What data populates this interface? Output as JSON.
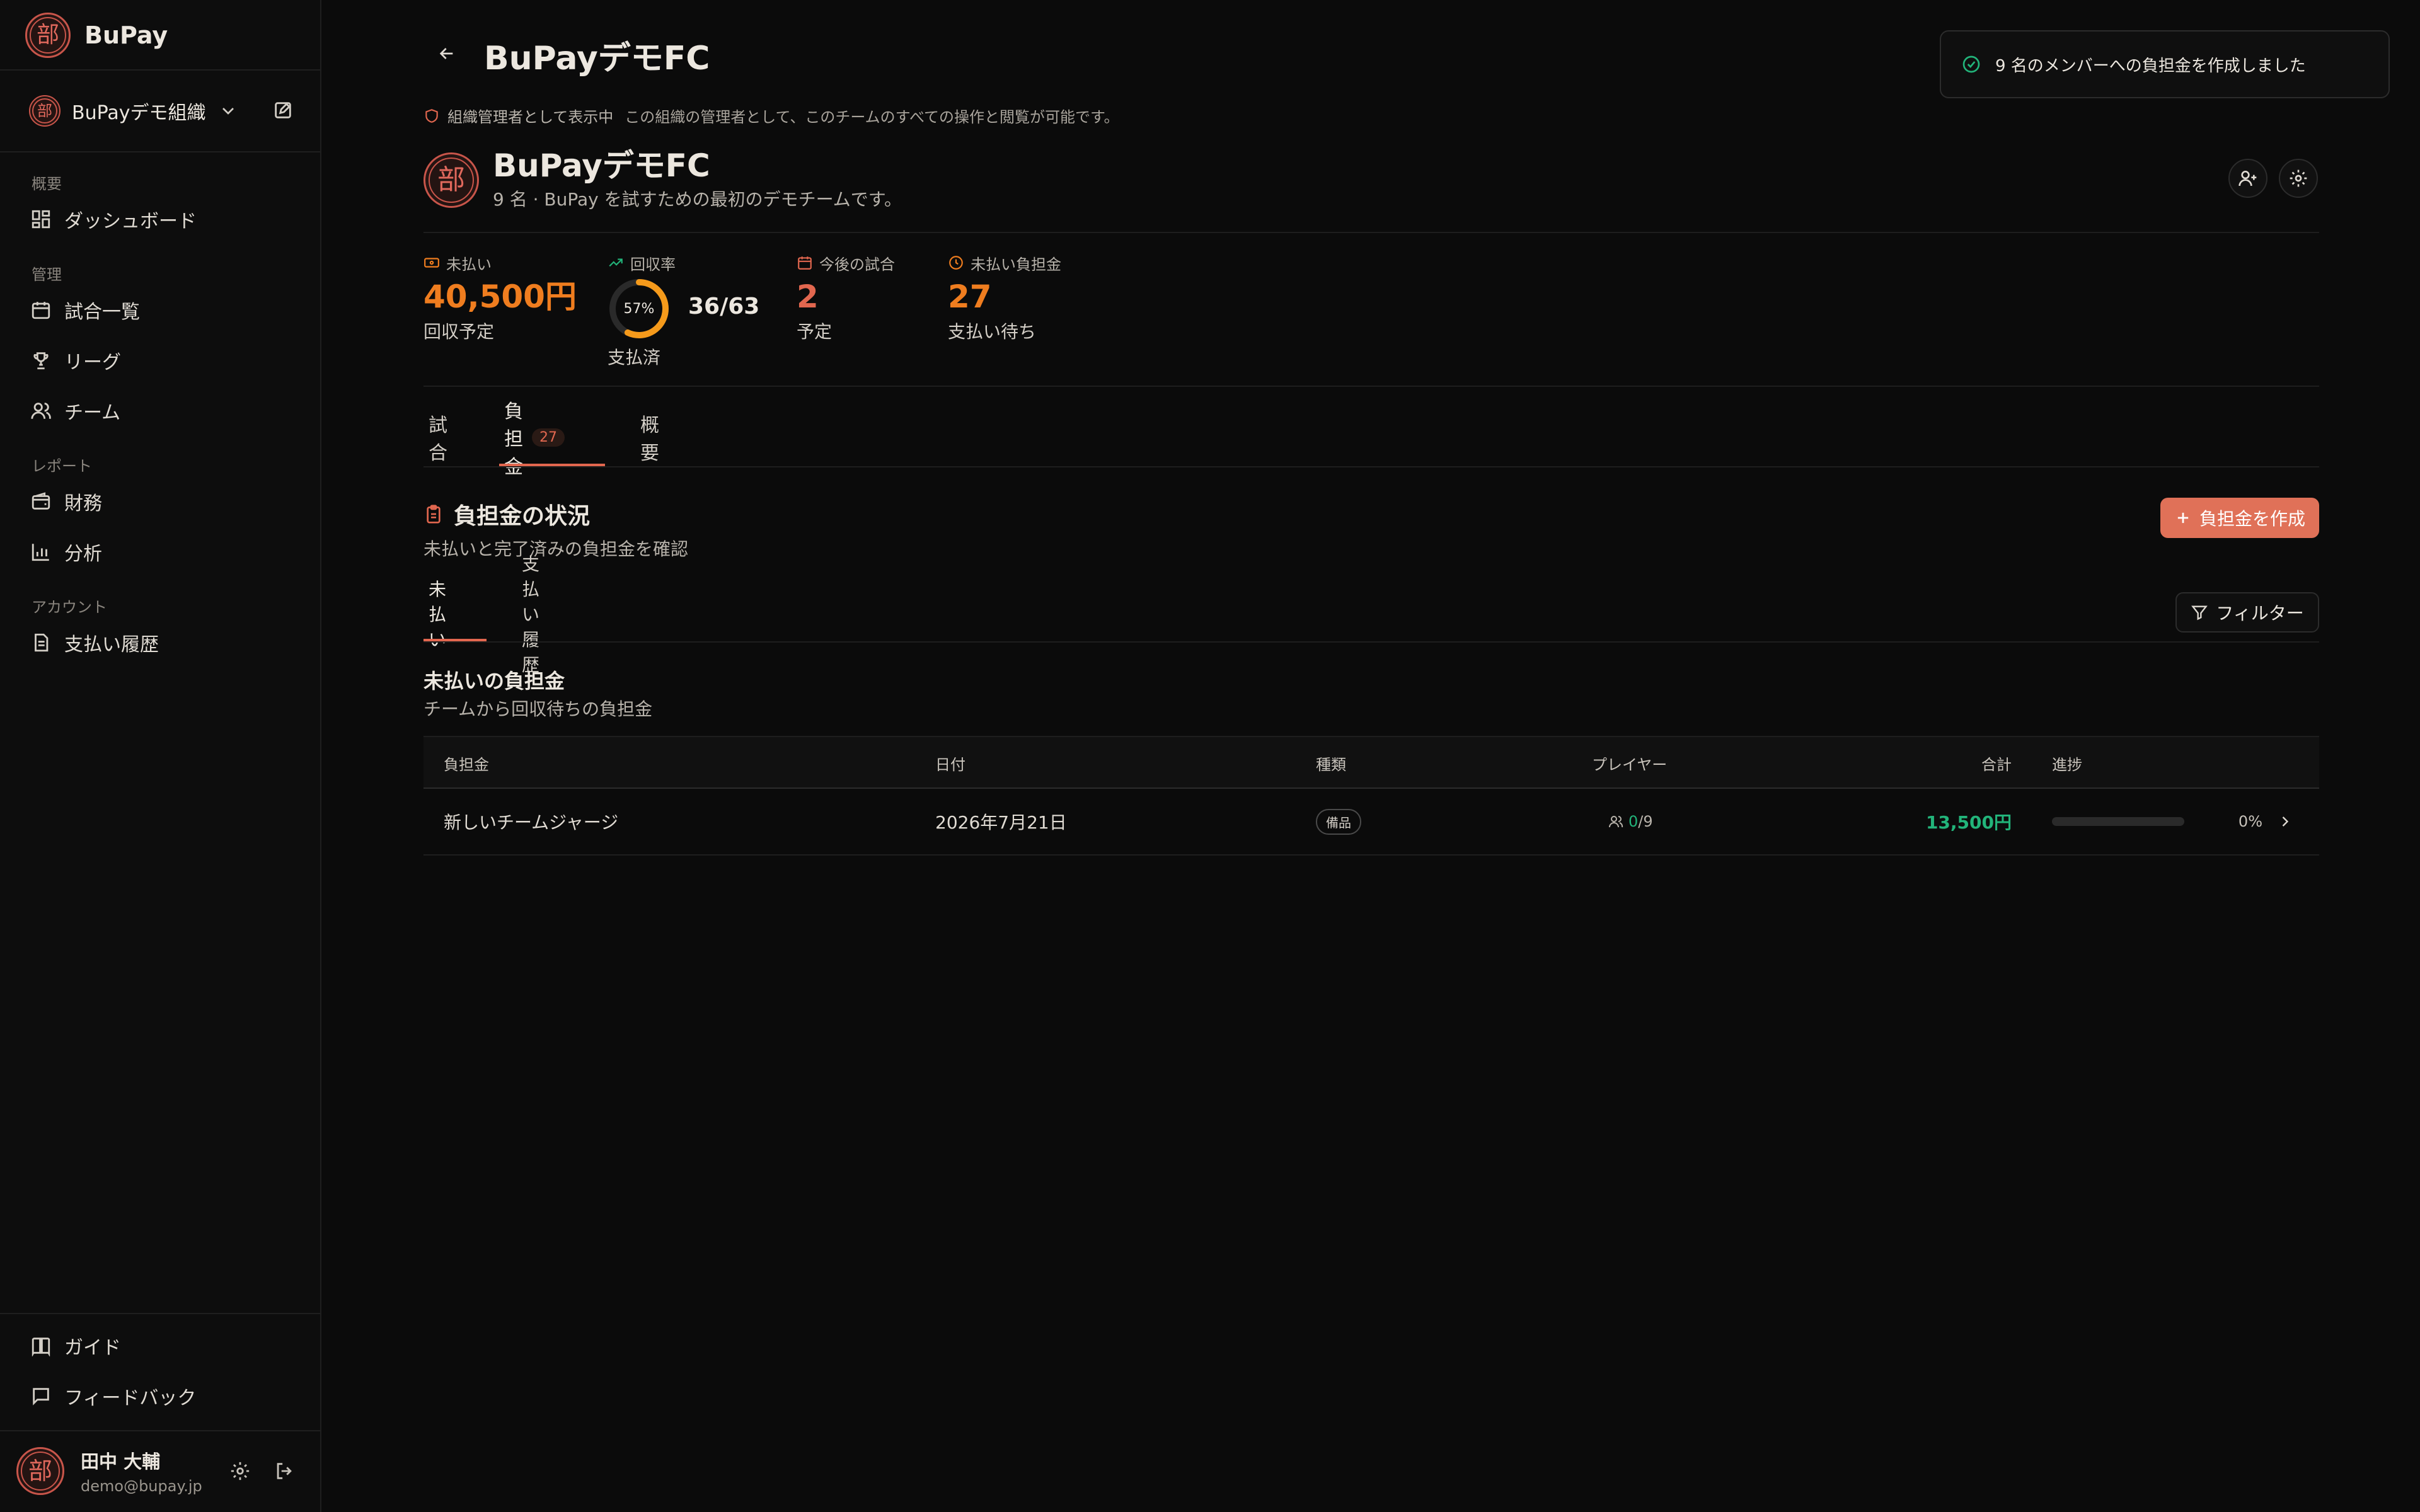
{
  "app": {
    "name": "BuPay",
    "seal_char": "部"
  },
  "org": {
    "name": "BuPayデモ組織"
  },
  "nav": {
    "sections": [
      {
        "label": "概要",
        "items": [
          {
            "label": "ダッシュボード",
            "icon": "grid-icon"
          }
        ]
      },
      {
        "label": "管理",
        "items": [
          {
            "label": "試合一覧",
            "icon": "calendar-icon"
          },
          {
            "label": "リーグ",
            "icon": "trophy-icon"
          },
          {
            "label": "チーム",
            "icon": "users-icon"
          }
        ]
      },
      {
        "label": "レポート",
        "items": [
          {
            "label": "財務",
            "icon": "wallet-icon"
          },
          {
            "label": "分析",
            "icon": "bar-chart-icon"
          }
        ]
      },
      {
        "label": "アカウント",
        "items": [
          {
            "label": "支払い履歴",
            "icon": "file-icon"
          }
        ]
      }
    ],
    "footer": [
      {
        "label": "ガイド",
        "icon": "book-icon"
      },
      {
        "label": "フィードバック",
        "icon": "message-icon"
      }
    ]
  },
  "user": {
    "name": "田中 大輔",
    "email": "demo@bupay.jp"
  },
  "page": {
    "title": "BuPayデモFC",
    "admin_notice": {
      "strong": "組織管理者として表示中",
      "desc": "この組織の管理者として、このチームのすべての操作と閲覧が可能です。"
    }
  },
  "team": {
    "name": "BuPayデモFC",
    "subtitle": "9 名 · BuPay を試すための最初のデモチームです。"
  },
  "stats": {
    "unpaid": {
      "label": "未払い",
      "value": "40,500円",
      "sub": "回収予定"
    },
    "collection": {
      "label": "回収率",
      "percent": 57,
      "percent_text": "57%",
      "count": "36/63",
      "sub": "支払済"
    },
    "upcoming": {
      "label": "今後の試合",
      "value": "2",
      "sub": "予定"
    },
    "pending": {
      "label": "未払い負担金",
      "value": "27",
      "sub": "支払い待ち"
    }
  },
  "tabs": [
    {
      "label": "試合"
    },
    {
      "label": "負担金",
      "badge": "27"
    },
    {
      "label": "概要"
    }
  ],
  "section": {
    "title": "負担金の状況",
    "desc": "未払いと完了済みの負担金を確認",
    "create_label": "負担金を作成"
  },
  "subtabs": [
    {
      "label": "未払い"
    },
    {
      "label": "支払い履歴"
    }
  ],
  "filter_label": "フィルター",
  "list": {
    "title": "未払いの負担金",
    "desc": "チームから回収待ちの負担金"
  },
  "table": {
    "headers": {
      "name": "負担金",
      "date": "日付",
      "type": "種類",
      "players": "プレイヤー",
      "total": "合計",
      "progress": "進捗"
    },
    "rows": [
      {
        "name": "新しいチームジャージ",
        "date": "2026年7月21日",
        "type": "備品",
        "players_paid": "0",
        "players_total": "/9",
        "total": "13,500円",
        "progress": 0,
        "progress_text": "0%"
      }
    ]
  },
  "toast": {
    "message": "9 名のメンバーへの負担金を作成しました"
  },
  "colors": {
    "accent": "#e07158",
    "orange": "#ef7d1f",
    "green": "#22b47a",
    "background": "#0b0b0b"
  }
}
